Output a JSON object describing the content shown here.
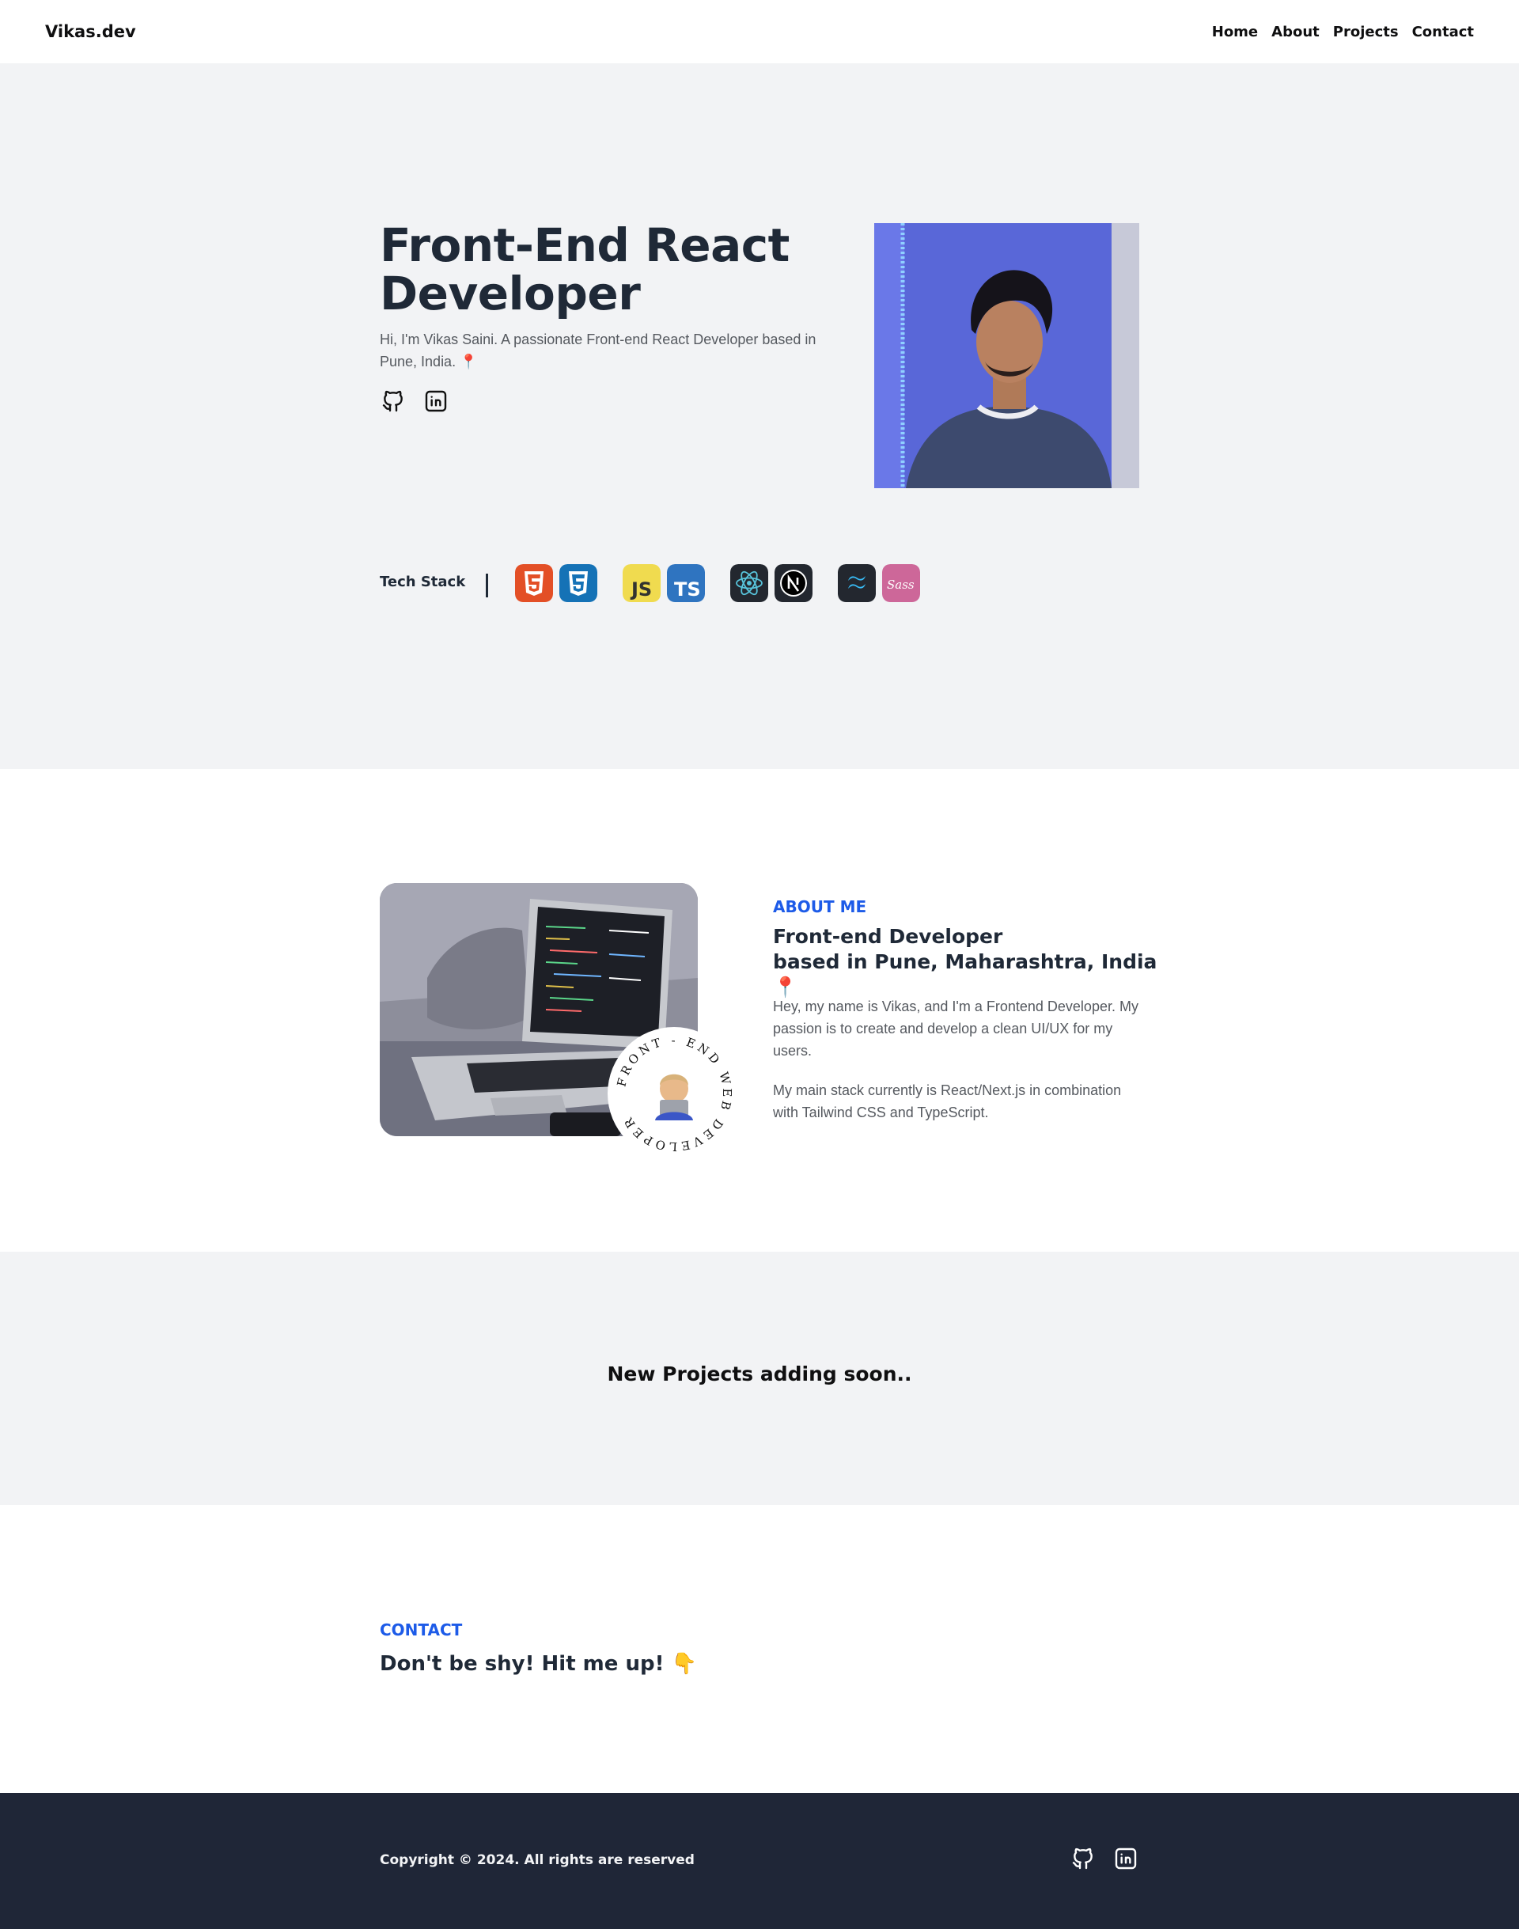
{
  "nav": {
    "brand": "Vikas.dev",
    "links": [
      "Home",
      "About",
      "Projects",
      "Contact"
    ]
  },
  "hero": {
    "title_line1": "Front-End React",
    "title_line2": "Developer",
    "subtitle": "Hi, I'm Vikas Saini. A passionate Front-end React Developer based in Pune, India. 📍",
    "social_icons": [
      "github-icon",
      "linkedin-icon"
    ],
    "portrait_alt": "profile photo"
  },
  "tech": {
    "label": "Tech Stack",
    "icons": [
      "html5-icon",
      "css3-icon",
      "javascript-icon",
      "typescript-icon",
      "react-icon",
      "nextjs-icon",
      "tailwind-icon",
      "sass-icon"
    ],
    "js_text": "JS",
    "ts_text": "TS",
    "sass_text": "Sass"
  },
  "about": {
    "eyebrow": "ABOUT ME",
    "title_line1": "Front-end Developer",
    "title_line2": "based in Pune, Maharashtra, India 📍",
    "p1": "Hey, my name is Vikas, and I'm a Frontend Developer. My passion is to create and develop a clean UI/UX for my users.",
    "p2": "My main stack currently is React/Next.js in combination with Tailwind CSS and TypeScript.",
    "badge_text": "FRONT - END WEB DEVELOPER"
  },
  "projects": {
    "message": "New Projects adding soon.."
  },
  "contact": {
    "eyebrow": "CONTACT",
    "title": "Don't be shy! Hit me up! 👇"
  },
  "footer": {
    "copyright": "Copyright © 2024. All rights are reserved"
  },
  "colors": {
    "accent": "#1d5be8",
    "hero_bg": "#f2f3f5",
    "footer_bg": "#1f2637",
    "text_dark": "#1f2937"
  }
}
